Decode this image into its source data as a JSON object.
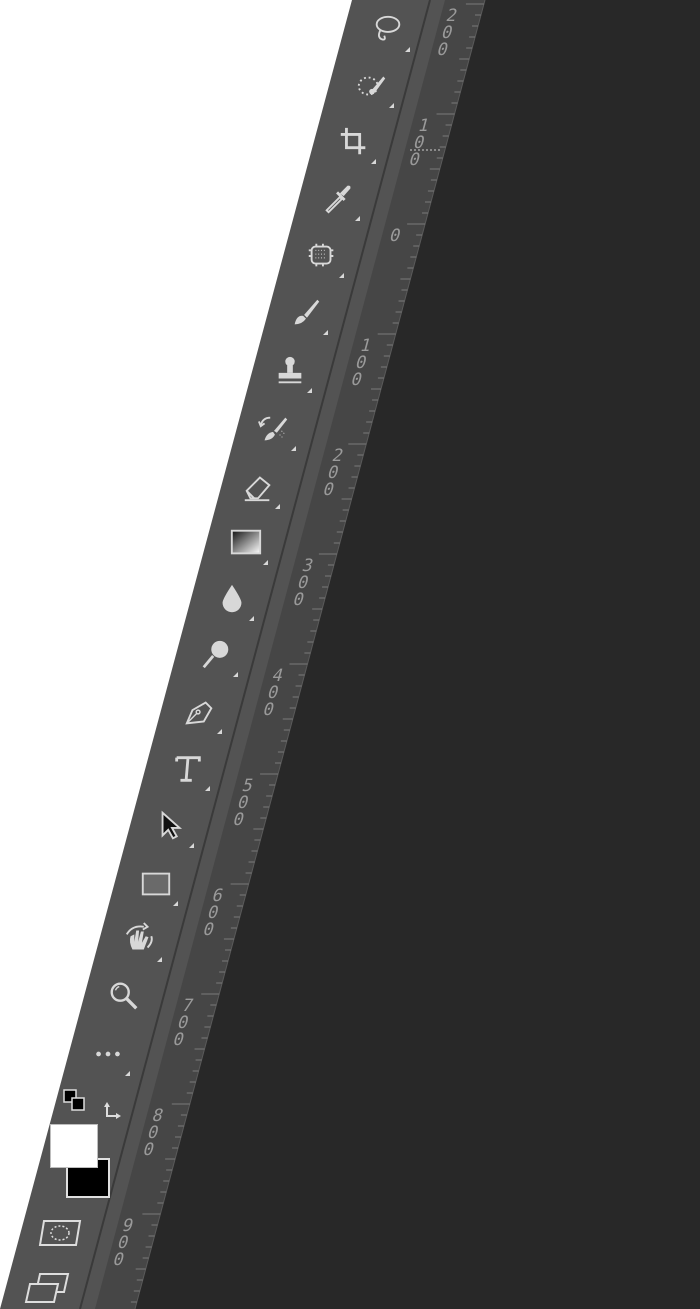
{
  "toolbar": {
    "tools": [
      {
        "name": "lasso-tool",
        "icon": "lasso-icon",
        "label": "Lasso Tool"
      },
      {
        "name": "quick-selection-tool",
        "icon": "quick-selection-icon",
        "label": "Quick Selection Tool"
      },
      {
        "name": "crop-tool",
        "icon": "crop-icon",
        "label": "Crop Tool"
      },
      {
        "name": "eyedropper-tool",
        "icon": "eyedropper-icon",
        "label": "Eyedropper Tool"
      },
      {
        "name": "healing-brush-tool",
        "icon": "patch-icon",
        "label": "Spot Healing Brush Tool"
      },
      {
        "name": "brush-tool",
        "icon": "brush-icon",
        "label": "Brush Tool"
      },
      {
        "name": "clone-stamp-tool",
        "icon": "stamp-icon",
        "label": "Clone Stamp Tool"
      },
      {
        "name": "history-brush-tool",
        "icon": "history-brush-icon",
        "label": "History Brush Tool"
      },
      {
        "name": "eraser-tool",
        "icon": "eraser-icon",
        "label": "Eraser Tool"
      },
      {
        "name": "gradient-tool",
        "icon": "gradient-icon",
        "label": "Gradient Tool"
      },
      {
        "name": "blur-tool",
        "icon": "drop-icon",
        "label": "Blur Tool"
      },
      {
        "name": "dodge-tool",
        "icon": "dodge-icon",
        "label": "Dodge Tool"
      },
      {
        "name": "pen-tool",
        "icon": "pen-icon",
        "label": "Pen Tool"
      },
      {
        "name": "type-tool",
        "icon": "type-icon",
        "label": "Horizontal Type Tool"
      },
      {
        "name": "path-selection-tool",
        "icon": "arrow-cursor-icon",
        "label": "Path Selection Tool"
      },
      {
        "name": "rectangle-tool",
        "icon": "rectangle-icon",
        "label": "Rectangle Tool"
      },
      {
        "name": "hand-rotate-tool",
        "icon": "hand-rotate-icon",
        "label": "Hand Tool"
      },
      {
        "name": "zoom-tool",
        "icon": "magnifier-icon",
        "label": "Zoom Tool"
      },
      {
        "name": "edit-toolbar",
        "icon": "ellipsis-icon",
        "label": "Edit Toolbar"
      }
    ],
    "colors": {
      "foreground": "#ffffff",
      "background": "#000000"
    },
    "extra_icons": [
      "default-colors-icon",
      "swap-colors-icon",
      "quick-mask-icon",
      "screen-mode-icon"
    ]
  },
  "ruler": {
    "labels": [
      "200",
      "100",
      "0",
      "100",
      "200",
      "300",
      "400",
      "500",
      "600",
      "700",
      "800",
      "900"
    ]
  },
  "theme": {
    "toolbar_bg": "#535353",
    "ruler_bg": "#464646",
    "canvas_bg": "#282828",
    "icon_color": "#d8d8d8"
  }
}
